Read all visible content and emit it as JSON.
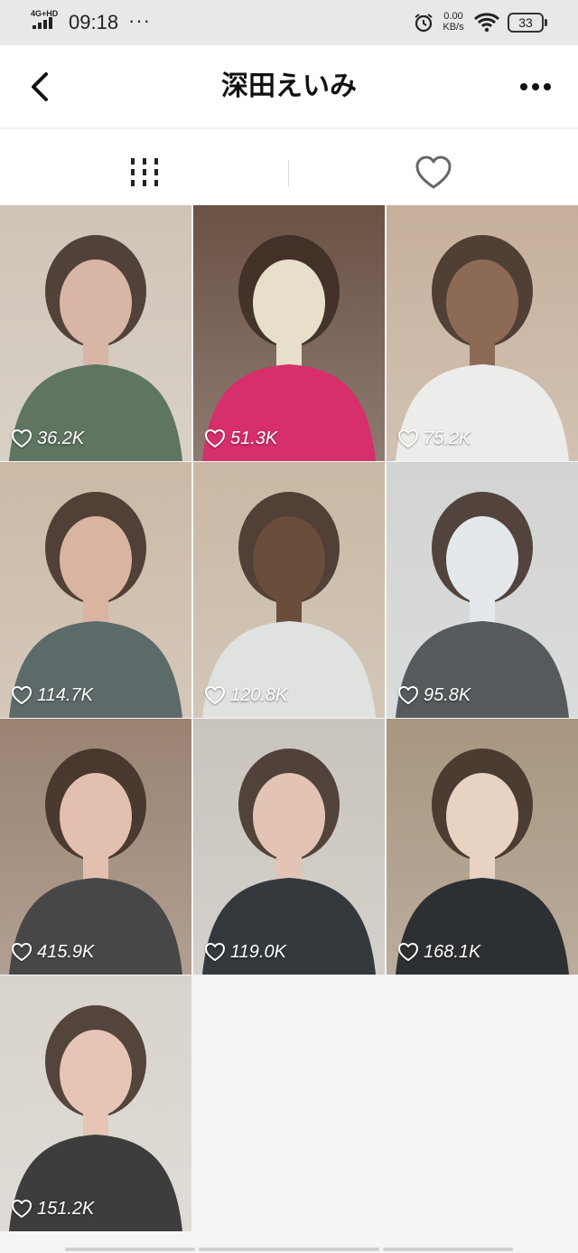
{
  "status_bar": {
    "network": "4G+HD",
    "time": "09:18",
    "more": "···",
    "speed_value": "0.00",
    "speed_unit": "KB/s",
    "battery": "33"
  },
  "header": {
    "title": "深田えいみ",
    "back_icon": "chevron-left-icon",
    "more_icon": "more-horizontal-icon"
  },
  "tabs": [
    {
      "name": "posts",
      "icon": "grid-columns-icon",
      "active": true
    },
    {
      "name": "liked",
      "icon": "heart-outline-icon",
      "active": false
    }
  ],
  "posts": [
    {
      "likes": "36.2K",
      "colors": [
        "#cfc4b7",
        "#5e7560",
        "#d9b5a6"
      ]
    },
    {
      "likes": "51.3K",
      "colors": [
        "#6a5244",
        "#d62f6b",
        "#e7dfca"
      ]
    },
    {
      "likes": "75.2K",
      "colors": [
        "#c6b09c",
        "#ececea",
        "#8d6a55"
      ]
    },
    {
      "likes": "114.7K",
      "colors": [
        "#cbb9a6",
        "#5d6a6a",
        "#d9b4a1"
      ]
    },
    {
      "likes": "120.8K",
      "colors": [
        "#c8b8a4",
        "#dfe2df",
        "#6b4d3b"
      ]
    },
    {
      "likes": "95.8K",
      "colors": [
        "#d2d3d3",
        "#555a5c",
        "#e5e8ea"
      ]
    },
    {
      "likes": "415.9K",
      "colors": [
        "#9a8371",
        "#474747",
        "#e3bfb0"
      ]
    },
    {
      "likes": "119.0K",
      "colors": [
        "#c9c4bd",
        "#33393d",
        "#e3c3b3"
      ]
    },
    {
      "likes": "168.1K",
      "colors": [
        "#a7957f",
        "#2d3032",
        "#e8d2c2"
      ]
    },
    {
      "likes": "151.2K",
      "colors": [
        "#d8d3cc",
        "#3d3d3d",
        "#e6c4b6"
      ]
    }
  ],
  "colors": {
    "status_bar_bg": "#e8e8e8",
    "header_bg": "#ffffff",
    "page_bg": "#f5f5f5",
    "icon": "#222222",
    "like_text": "#ffffff"
  }
}
